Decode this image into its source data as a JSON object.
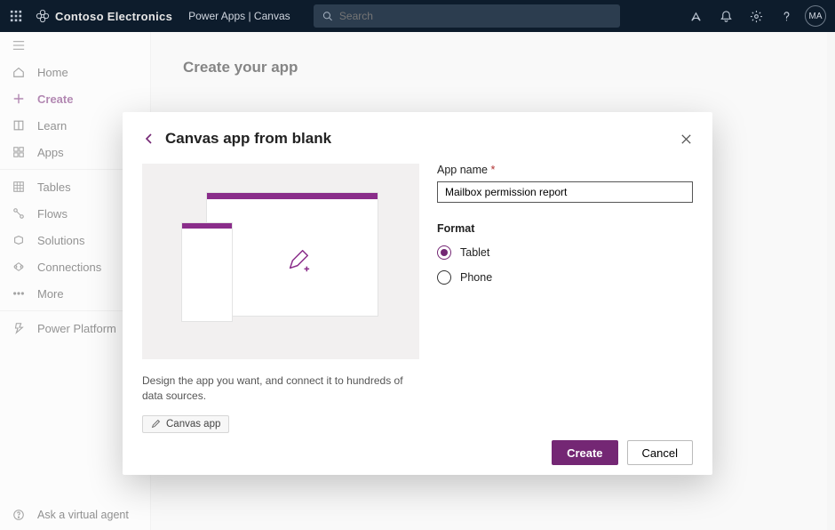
{
  "topbar": {
    "brand": "Contoso Electronics",
    "breadcrumb": "Power Apps  |  Canvas",
    "search_placeholder": "Search",
    "avatar_initials": "MA"
  },
  "sidebar": {
    "items": {
      "home": "Home",
      "create": "Create",
      "learn": "Learn",
      "apps": "Apps",
      "tables": "Tables",
      "flows": "Flows",
      "solutions": "Solutions",
      "connections": "Connections",
      "more": "More",
      "powerplatform": "Power Platform"
    },
    "virtual_agent": "Ask a virtual agent"
  },
  "main": {
    "heading": "Create your app"
  },
  "modal": {
    "title": "Canvas app from blank",
    "description": "Design the app you want, and connect it to hundreds of data sources.",
    "badge": "Canvas app",
    "fields": {
      "app_name_label": "App name",
      "app_name_value": "Mailbox permission report",
      "format_label": "Format",
      "option_tablet": "Tablet",
      "option_phone": "Phone"
    },
    "buttons": {
      "create": "Create",
      "cancel": "Cancel"
    }
  },
  "colors": {
    "accent": "#742774",
    "topbar": "#0d1c2c"
  }
}
